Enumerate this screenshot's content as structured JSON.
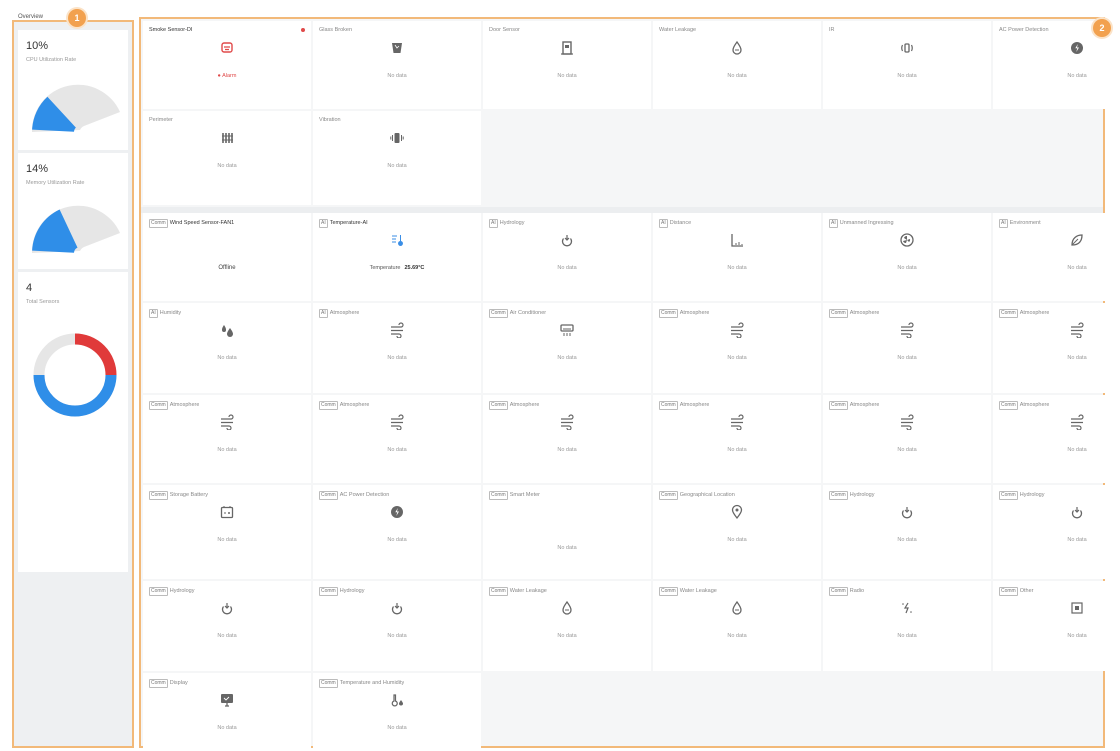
{
  "overview": {
    "title": "Overview",
    "badge": "1",
    "cpu": {
      "value": "10%",
      "label": "CPU Utilization Rate",
      "fraction": 0.1
    },
    "memory": {
      "value": "14%",
      "label": "Memory Utilization Rate",
      "fraction": 0.14
    },
    "sensors": {
      "value": "4",
      "label": "Total Sensors",
      "alarm_fraction": 0.25,
      "normal_fraction": 0.5
    },
    "colors": {
      "gauge": "#2f8ee8",
      "alarm": "#e03a3a",
      "normal": "#2f8ee8",
      "track": "#e6e6e6"
    }
  },
  "grid": {
    "badge": "2",
    "colors": {
      "icon": "#666666",
      "alarm": "#e04a4a",
      "temp": "#3a8ee6"
    },
    "rows": [
      [
        {
          "tag": "",
          "title": "Smoke Sensor-DI",
          "icon": "smoke-icon",
          "status": "● Alarm",
          "kind": "alarm",
          "dark": true,
          "dot": true
        },
        {
          "tag": "",
          "title": "Glass Broken",
          "icon": "glass-icon",
          "status": "No data"
        },
        {
          "tag": "",
          "title": "Door Sensor",
          "icon": "door-icon",
          "status": "No data"
        },
        {
          "tag": "",
          "title": "Water Leakage",
          "icon": "water-leak-icon",
          "status": "No data"
        },
        {
          "tag": "",
          "title": "IR",
          "icon": "ir-icon",
          "status": "No data"
        },
        {
          "tag": "",
          "title": "AC Power Detection",
          "icon": "power-icon",
          "status": "No data"
        }
      ],
      [
        {
          "tag": "",
          "title": "Perimeter",
          "icon": "perimeter-icon",
          "status": "No data"
        },
        {
          "tag": "",
          "title": "Vibration",
          "icon": "vibration-icon",
          "status": "No data"
        }
      ],
      [
        {
          "tag": "Comm",
          "title": "Wind Speed Sensor-FAN1",
          "icon": "",
          "status": "Offline",
          "kind": "offline",
          "dark": true
        },
        {
          "tag": "AI",
          "title": "Temperature-AI",
          "icon": "temperature-icon",
          "status": "Temperature",
          "reading": "25.69°C",
          "kind": "reading",
          "dark": true,
          "accent": true
        },
        {
          "tag": "AI",
          "title": "Hydrology",
          "icon": "hydrology-icon",
          "status": "No data"
        },
        {
          "tag": "AI",
          "title": "Distance",
          "icon": "distance-icon",
          "status": "No data"
        },
        {
          "tag": "AI",
          "title": "Unmanned Ingressing",
          "icon": "fan-icon",
          "status": "No data"
        },
        {
          "tag": "AI",
          "title": "Environment",
          "icon": "leaf-icon",
          "status": "No data"
        }
      ],
      [
        {
          "tag": "AI",
          "title": "Humidity",
          "icon": "humidity-icon",
          "status": "No data"
        },
        {
          "tag": "AI",
          "title": "Atmosphere",
          "icon": "atmosphere-icon",
          "status": "No data"
        },
        {
          "tag": "Comm",
          "title": "Air Conditioner",
          "icon": "air-conditioner-icon",
          "status": "No data"
        },
        {
          "tag": "Comm",
          "title": "Atmosphere",
          "icon": "atmosphere-icon",
          "status": "No data"
        },
        {
          "tag": "Comm",
          "title": "Atmosphere",
          "icon": "atmosphere-icon",
          "status": "No data"
        },
        {
          "tag": "Comm",
          "title": "Atmosphere",
          "icon": "atmosphere-icon",
          "status": "No data"
        }
      ],
      [
        {
          "tag": "Comm",
          "title": "Atmosphere",
          "icon": "atmosphere-icon",
          "status": "No data"
        },
        {
          "tag": "Comm",
          "title": "Atmosphere",
          "icon": "atmosphere-icon",
          "status": "No data"
        },
        {
          "tag": "Comm",
          "title": "Atmosphere",
          "icon": "atmosphere-icon",
          "status": "No data"
        },
        {
          "tag": "Comm",
          "title": "Atmosphere",
          "icon": "atmosphere-icon",
          "status": "No data"
        },
        {
          "tag": "Comm",
          "title": "Atmosphere",
          "icon": "atmosphere-icon",
          "status": "No data"
        },
        {
          "tag": "Comm",
          "title": "Atmosphere",
          "icon": "atmosphere-icon",
          "status": "No data"
        }
      ],
      [
        {
          "tag": "Comm",
          "title": "Storage Battery",
          "icon": "battery-icon",
          "status": "No data"
        },
        {
          "tag": "Comm",
          "title": "AC Power Detection",
          "icon": "power-icon",
          "status": "No data"
        },
        {
          "tag": "Comm",
          "title": "Smart Meter",
          "icon": "",
          "status": "No data"
        },
        {
          "tag": "Comm",
          "title": "Geographical Location",
          "icon": "location-icon",
          "status": "No data"
        },
        {
          "tag": "Comm",
          "title": "Hydrology",
          "icon": "hydrology-icon",
          "status": "No data"
        },
        {
          "tag": "Comm",
          "title": "Hydrology",
          "icon": "hydrology-icon",
          "status": "No data"
        }
      ],
      [
        {
          "tag": "Comm",
          "title": "Hydrology",
          "icon": "hydrology-icon",
          "status": "No data"
        },
        {
          "tag": "Comm",
          "title": "Hydrology",
          "icon": "hydrology-icon",
          "status": "No data"
        },
        {
          "tag": "Comm",
          "title": "Water Leakage",
          "icon": "water-leak-icon",
          "status": "No data"
        },
        {
          "tag": "Comm",
          "title": "Water Leakage",
          "icon": "water-leak-icon",
          "status": "No data"
        },
        {
          "tag": "Comm",
          "title": "Radio",
          "icon": "radio-icon",
          "status": "No data"
        },
        {
          "tag": "Comm",
          "title": "Other",
          "icon": "other-icon",
          "status": "No data"
        }
      ],
      [
        {
          "tag": "Comm",
          "title": "Display",
          "icon": "display-icon",
          "status": "No data"
        },
        {
          "tag": "Comm",
          "title": "Temperature and Humidity",
          "icon": "temp-humidity-icon",
          "status": "No data"
        }
      ]
    ]
  }
}
